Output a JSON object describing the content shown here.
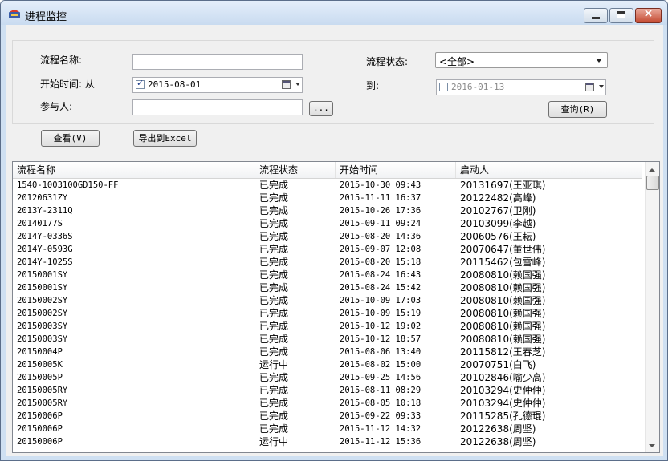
{
  "window": {
    "title": "进程监控"
  },
  "filter": {
    "name_label": "流程名称:",
    "name_value": "",
    "start_label": "开始时间: 从",
    "start_date": "2015-08-01",
    "start_checked": true,
    "participant_label": "参与人:",
    "participant_value": "",
    "browse_label": "...",
    "status_label": "流程状态:",
    "status_value": "<全部>",
    "to_label": "到:",
    "end_date": "2016-01-13",
    "end_checked": false,
    "query_label": "查询(R)"
  },
  "toolbar": {
    "view_label": "查看(V)",
    "export_label": "导出到Excel"
  },
  "table": {
    "columns": [
      "流程名称",
      "流程状态",
      "开始时间",
      "启动人"
    ],
    "rows": [
      [
        "1540-1003100GD150-FF",
        "已完成",
        "2015-10-30 09:43",
        "20131697(王亚琪)"
      ],
      [
        "20120631ZY",
        "已完成",
        "2015-11-11 16:37",
        "20122482(高峰)"
      ],
      [
        "2013Y-2311Q",
        "已完成",
        "2015-10-26 17:36",
        "20102767(卫刚)"
      ],
      [
        "20140177S",
        "已完成",
        "2015-09-11 09:24",
        "20103099(李越)"
      ],
      [
        "2014Y-0336S",
        "已完成",
        "2015-08-20 14:36",
        "20060576(王耘)"
      ],
      [
        "2014Y-0593G",
        "已完成",
        "2015-09-07 12:08",
        "20070647(董世伟)"
      ],
      [
        "2014Y-1025S",
        "已完成",
        "2015-08-20 15:18",
        "20115462(包雪峰)"
      ],
      [
        "20150001SY",
        "已完成",
        "2015-08-24 16:43",
        "20080810(赖国强)"
      ],
      [
        "20150001SY",
        "已完成",
        "2015-08-24 15:42",
        "20080810(赖国强)"
      ],
      [
        "20150002SY",
        "已完成",
        "2015-10-09 17:03",
        "20080810(赖国强)"
      ],
      [
        "20150002SY",
        "已完成",
        "2015-10-09 15:19",
        "20080810(赖国强)"
      ],
      [
        "20150003SY",
        "已完成",
        "2015-10-12 19:02",
        "20080810(赖国强)"
      ],
      [
        "20150003SY",
        "已完成",
        "2015-10-12 18:57",
        "20080810(赖国强)"
      ],
      [
        "20150004P",
        "已完成",
        "2015-08-06 13:40",
        "20115812(王春芝)"
      ],
      [
        "20150005K",
        "运行中",
        "2015-08-02 15:00",
        "20070751(白飞)"
      ],
      [
        "20150005P",
        "已完成",
        "2015-09-25 14:56",
        "20102846(喻少高)"
      ],
      [
        "20150005RY",
        "已完成",
        "2015-08-11 08:29",
        "20103294(史仲仲)"
      ],
      [
        "20150005RY",
        "已完成",
        "2015-08-05 10:18",
        "20103294(史仲仲)"
      ],
      [
        "20150006P",
        "已完成",
        "2015-09-22 09:33",
        "20115285(孔德琨)"
      ],
      [
        "20150006P",
        "已完成",
        "2015-11-12 14:32",
        "20122638(周坚)"
      ],
      [
        "20150006P",
        "运行中",
        "2015-11-12 15:36",
        "20122638(周坚)"
      ]
    ]
  }
}
